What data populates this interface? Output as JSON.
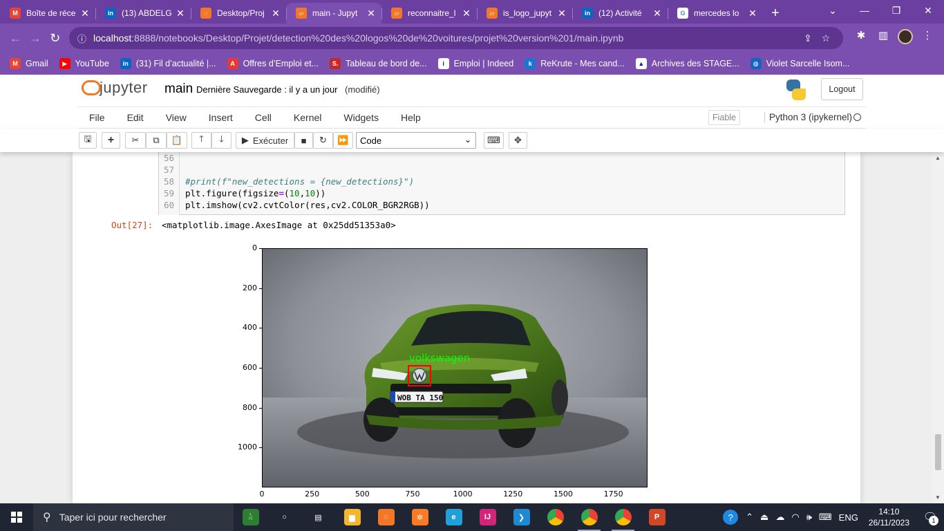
{
  "browser": {
    "tabs": [
      {
        "title": "Boîte de réce",
        "icon": "gmail-icon",
        "color": "#ea4335",
        "glyph": "M",
        "active": false
      },
      {
        "title": "(13) ABDELG",
        "icon": "linkedin-icon",
        "color": "#0a66c2",
        "glyph": "in",
        "active": false
      },
      {
        "title": "Desktop/Proj",
        "icon": "jupyter-loading-icon",
        "color": "#f37726",
        "glyph": "◌",
        "active": false
      },
      {
        "title": "main - Jupyt",
        "icon": "jupyter-notebook-icon",
        "color": "#f37726",
        "glyph": "▱",
        "active": true
      },
      {
        "title": "reconnaitre_l",
        "icon": "jupyter-notebook-icon",
        "color": "#f37726",
        "glyph": "▱",
        "active": false
      },
      {
        "title": "is_logo_jupyt",
        "icon": "jupyter-notebook-icon",
        "color": "#f37726",
        "glyph": "▱",
        "active": false
      },
      {
        "title": "(12) Activité",
        "icon": "linkedin-icon",
        "color": "#0a66c2",
        "glyph": "in",
        "active": false
      },
      {
        "title": "mercedes lo",
        "icon": "google-icon",
        "color": "#ffffff",
        "glyph": "G",
        "active": false
      }
    ],
    "new_tab": "+",
    "address": {
      "host": "localhost",
      "path": ":8888/notebooks/Desktop/Projet/detection%20des%20logos%20de%20voitures/projet%20version%201/main.ipynb"
    },
    "bookmarks": [
      {
        "label": "Gmail",
        "icon": "gmail-icon",
        "color": "#ea4335",
        "glyph": "M"
      },
      {
        "label": "YouTube",
        "icon": "youtube-icon",
        "color": "#ff0000",
        "glyph": "▶"
      },
      {
        "label": "(31) Fil d’actualité |...",
        "icon": "linkedin-icon",
        "color": "#0a66c2",
        "glyph": "in"
      },
      {
        "label": "Offres d’Emploi et...",
        "icon": "anapec-icon",
        "color": "#e53935",
        "glyph": "A"
      },
      {
        "label": "Tableau de bord de...",
        "icon": "sl-icon",
        "color": "#c62828",
        "glyph": "S."
      },
      {
        "label": "Emploi | Indeed",
        "icon": "indeed-icon",
        "color": "#ffffff",
        "glyph": "i"
      },
      {
        "label": "ReKrute - Mes cand...",
        "icon": "rekrute-icon",
        "color": "#1976d2",
        "glyph": "k"
      },
      {
        "label": "Archives des STAGE...",
        "icon": "archive-icon",
        "color": "#ffffff",
        "glyph": "▲"
      },
      {
        "label": "Violet Sarcelle Isom...",
        "icon": "canva-icon",
        "color": "#1565c0",
        "glyph": "◍"
      }
    ]
  },
  "jupyter": {
    "logo_text": "jupyter",
    "notebook_name": "main",
    "save_status": "Dernière Sauvegarde : il y a un jour",
    "modified": "(modifié)",
    "logout": "Logout",
    "menus": [
      "File",
      "Edit",
      "View",
      "Insert",
      "Cell",
      "Kernel",
      "Widgets",
      "Help"
    ],
    "trusted": "Fiable",
    "kernel": "Python 3 (ipykernel)",
    "run_label": "Exécuter",
    "cell_type": "Code"
  },
  "cell": {
    "lines": [
      {
        "n": "56",
        "code": ""
      },
      {
        "n": "57",
        "code": ""
      },
      {
        "n": "58",
        "code": "#print(f\"new_detections = {new_detections}\")"
      },
      {
        "n": "59",
        "code": "plt.figure(figsize=(10,10))"
      },
      {
        "n": "60",
        "code": "plt.imshow(cv2.cvtColor(res,cv2.COLOR_BGR2RGB))"
      }
    ],
    "out_prompt": "Out[27]:",
    "out_text": "<matplotlib.image.AxesImage at 0x25dd51353a0>"
  },
  "chart_data": {
    "type": "image",
    "detections": [
      {
        "label": "volkswagen",
        "box_color": "#ff0000",
        "text_color": "#00ff00"
      }
    ],
    "license_plate": "WOB TA 150",
    "y_ticks": [
      "0",
      "200",
      "400",
      "600",
      "800",
      "1000"
    ],
    "x_ticks": [
      "0",
      "250",
      "500",
      "750",
      "1000",
      "1250",
      "1500",
      "1750"
    ],
    "xlim": [
      0,
      1920
    ],
    "ylim": [
      1200,
      0
    ]
  },
  "taskbar": {
    "search_placeholder": "Taper ici pour rechercher",
    "apps": [
      {
        "icon": "cortana-icon",
        "glyph": "○",
        "color": "transparent",
        "run": false
      },
      {
        "icon": "task-view-icon",
        "glyph": "▤",
        "color": "transparent",
        "run": false
      },
      {
        "icon": "file-explorer-icon",
        "glyph": "▆",
        "color": "#f2b631",
        "run": false
      },
      {
        "icon": "jupyter-app-icon",
        "glyph": "◌",
        "color": "#f37726",
        "run": false
      },
      {
        "icon": "xampp-icon",
        "glyph": "✲",
        "color": "#fb7a24",
        "run": false
      },
      {
        "icon": "edge-icon",
        "glyph": "e",
        "color": "#1fa0d8",
        "run": false
      },
      {
        "icon": "intellij-icon",
        "glyph": "IJ",
        "color": "#d3247b",
        "run": false
      },
      {
        "icon": "vscode-icon",
        "glyph": "❯",
        "color": "#1f8ad2",
        "run": false
      },
      {
        "icon": "chrome-icon",
        "glyph": "●",
        "color": "#34a853",
        "run": false
      },
      {
        "icon": "chrome-profile-icon",
        "glyph": "●",
        "color": "#34a853",
        "run": true
      },
      {
        "icon": "chrome-profile-2-icon",
        "glyph": "●",
        "color": "#34a853",
        "run": true
      },
      {
        "icon": "powerpoint-icon",
        "glyph": "P",
        "color": "#d24726",
        "run": false
      }
    ],
    "lang": "ENG",
    "time": "14:10",
    "date": "26/11/2023",
    "notifications": "1"
  }
}
